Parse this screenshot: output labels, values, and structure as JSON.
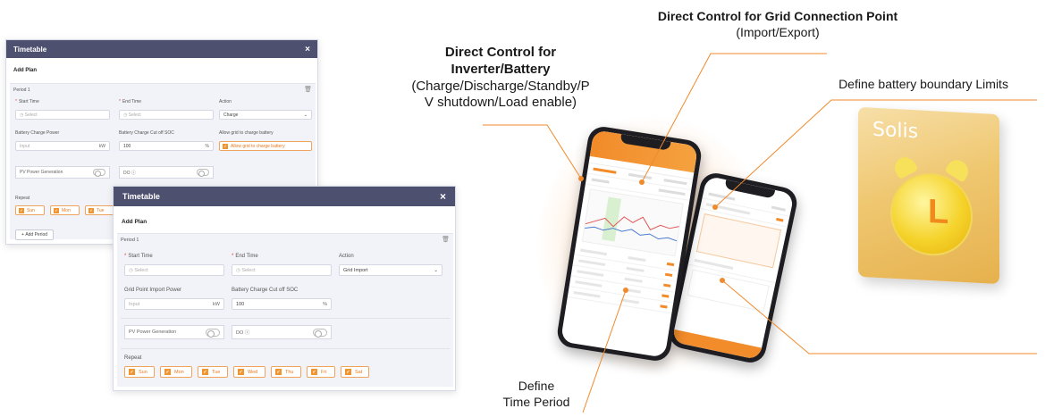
{
  "dialog_back": {
    "header_title": "Timetable",
    "close": "×",
    "section_title": "Add Plan",
    "period_label": "Period 1",
    "start_time_label": "Start Time",
    "end_time_label": "End Time",
    "action_label": "Action",
    "start_time_placeholder": "Select",
    "end_time_placeholder": "Select",
    "action_value": "Charge",
    "power_label": "Battery Charge Power",
    "power_placeholder": "Input",
    "power_unit": "kW",
    "soc_label": "Battery Charge Cut off SOC",
    "soc_value": "100",
    "soc_unit": "%",
    "grid_label": "Allow grid to charge battery",
    "grid_checkbox": "Allow grid to charge battery",
    "pv_label": "PV Power Generation",
    "do_label": "DO",
    "repeat_label": "Repeat",
    "days": [
      "Sun",
      "Mon",
      "Tue"
    ],
    "add_period": "Add Period"
  },
  "dialog_front": {
    "header_title": "Timetable",
    "close": "×",
    "section_title": "Add Plan",
    "period_label": "Period 1",
    "start_time_label": "Start Time",
    "end_time_label": "End Time",
    "action_label": "Action",
    "start_time_placeholder": "Select",
    "end_time_placeholder": "Select",
    "action_value": "Grid Import",
    "power_label": "Grid Point Import Power",
    "power_placeholder": "Input",
    "power_unit": "kW",
    "soc_label": "Battery Charge Cut off SOC",
    "soc_value": "100",
    "soc_unit": "%",
    "pv_label": "PV Power Generation",
    "do_label": "DO",
    "repeat_label": "Repeat",
    "days": [
      "Sun",
      "Mon",
      "Tue",
      "Wed",
      "Thu",
      "Fri",
      "Sat"
    ]
  },
  "annotations": {
    "inverter_title_line1": "Direct Control for",
    "inverter_title_line2": "Inverter/Battery",
    "inverter_desc_line1": "(Charge/Discharge/Standby/P",
    "inverter_desc_line2": "V shutdown/Load enable)",
    "grid_title": "Direct Control for Grid Connection Point",
    "grid_desc": "(Import/Export)",
    "battery_limits": "Define battery boundary Limits",
    "time_line1": "Define",
    "time_line2": "Time Period"
  },
  "app_icon": {
    "brand": "Solis"
  },
  "colors": {
    "header_bg": "#4e5070",
    "accent_orange": "#f0952f",
    "panel_bg": "#f2f3f8"
  }
}
